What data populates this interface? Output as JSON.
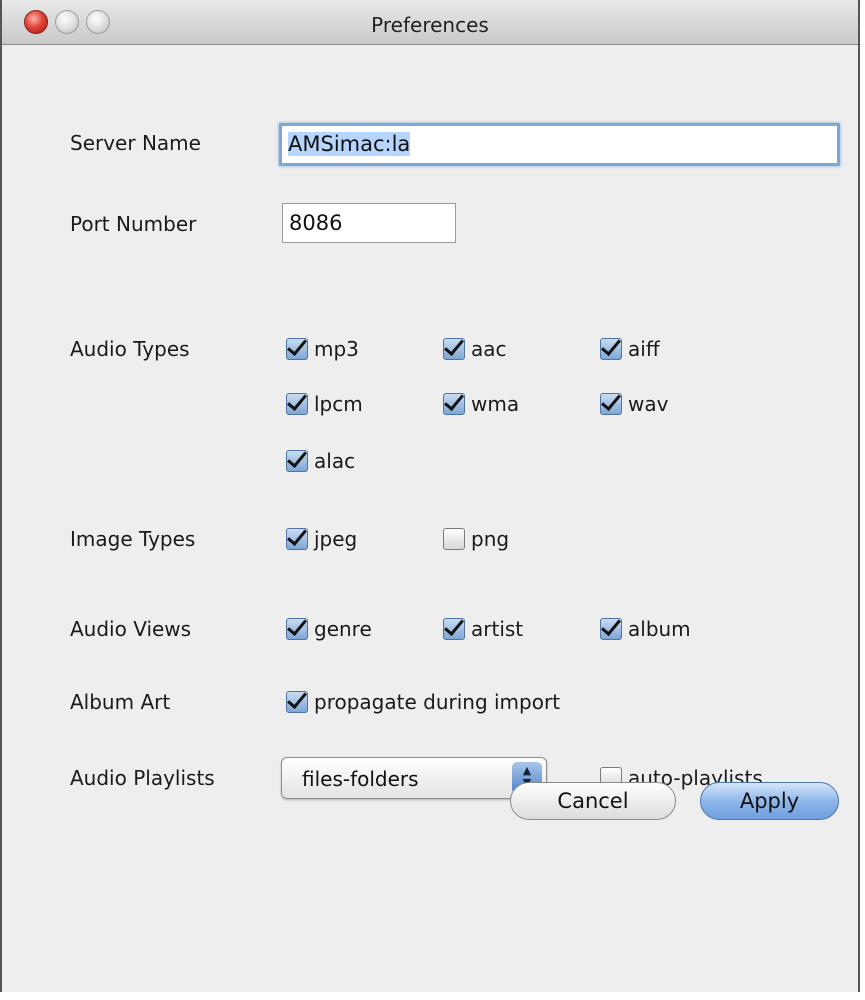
{
  "window": {
    "title": "Preferences"
  },
  "server_name": {
    "label": "Server Name",
    "value": "AMSimac:la"
  },
  "port_number": {
    "label": "Port Number",
    "value": "8086"
  },
  "audio_types": {
    "label": "Audio Types",
    "items": [
      {
        "label": "mp3",
        "checked": true
      },
      {
        "label": "aac",
        "checked": true
      },
      {
        "label": "aiff",
        "checked": true
      },
      {
        "label": "lpcm",
        "checked": true
      },
      {
        "label": "wma",
        "checked": true
      },
      {
        "label": "wav",
        "checked": true
      },
      {
        "label": "alac",
        "checked": true
      }
    ]
  },
  "image_types": {
    "label": "Image Types",
    "items": [
      {
        "label": "jpeg",
        "checked": true
      },
      {
        "label": "png",
        "checked": false
      }
    ]
  },
  "audio_views": {
    "label": "Audio Views",
    "items": [
      {
        "label": "genre",
        "checked": true
      },
      {
        "label": "artist",
        "checked": true
      },
      {
        "label": "album",
        "checked": true
      }
    ]
  },
  "album_art": {
    "label": "Album Art",
    "option": {
      "label": "propagate during import",
      "checked": true
    }
  },
  "audio_playlists": {
    "label": "Audio Playlists",
    "selected": "files-folders",
    "auto_playlists": {
      "label": "auto-playlists",
      "checked": false
    }
  },
  "buttons": {
    "cancel": "Cancel",
    "apply": "Apply"
  }
}
